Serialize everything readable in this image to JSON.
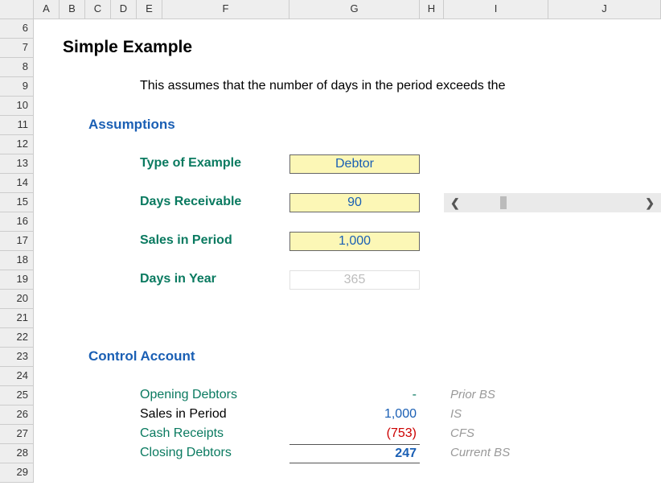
{
  "columns": [
    "A",
    "B",
    "C",
    "D",
    "E",
    "F",
    "G",
    "H",
    "I",
    "J"
  ],
  "rows": [
    "6",
    "7",
    "8",
    "9",
    "10",
    "11",
    "12",
    "13",
    "14",
    "15",
    "16",
    "17",
    "18",
    "19",
    "20",
    "21",
    "22",
    "23",
    "24",
    "25",
    "26",
    "27",
    "28",
    "29"
  ],
  "title": "Simple Example",
  "subtitle": "This assumes that the number of days in the period exceeds the",
  "sections": {
    "assumptions": "Assumptions",
    "control": "Control Account"
  },
  "assumptions": {
    "type_label": "Type of Example",
    "type_value": "Debtor",
    "days_recv_label": "Days Receivable",
    "days_recv_value": "90",
    "sales_label": "Sales in Period",
    "sales_value": "1,000",
    "days_year_label": "Days in Year",
    "days_year_value": "365"
  },
  "control": {
    "opening_label": "Opening Debtors",
    "opening_value": "-",
    "opening_note": "Prior BS",
    "sales_label": "Sales in Period",
    "sales_value": "1,000",
    "sales_note": "IS",
    "cash_label": "Cash Receipts",
    "cash_value": "(753)",
    "cash_note": "CFS",
    "closing_label": "Closing Debtors",
    "closing_value": "247",
    "closing_note": "Current BS"
  }
}
